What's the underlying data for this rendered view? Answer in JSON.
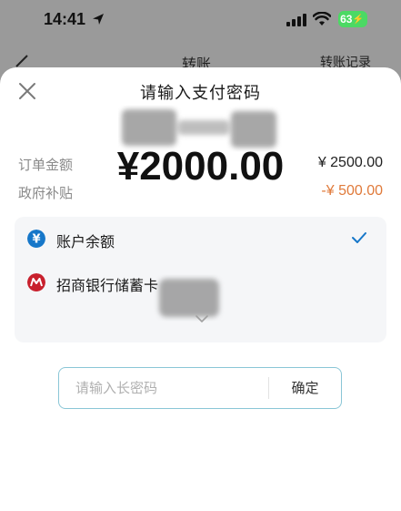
{
  "status_bar": {
    "time": "14:41",
    "battery": "63",
    "icons": [
      "location-arrow-icon",
      "signal-bars-icon",
      "wifi-icon",
      "battery-charging-icon"
    ]
  },
  "background_page": {
    "title": "转账",
    "right_link": "转账记录"
  },
  "sheet": {
    "title": "请输入支付密码",
    "amount": "¥2000.00",
    "order_amount": {
      "label": "订单金额",
      "value": "¥ 2500.00"
    },
    "subsidy": {
      "label": "政府补贴",
      "value": "-¥ 500.00"
    },
    "payment_methods": [
      {
        "label": "账户余额",
        "icon": "yuan-coin-icon",
        "selected": true
      },
      {
        "label": "招商银行储蓄卡",
        "icon": "cmb-bank-icon",
        "selected": false
      }
    ],
    "password_placeholder": "请输入长密码",
    "confirm_label": "确定"
  },
  "colors": {
    "accent_blue": "#1677c9",
    "discount_orange": "#e07a3a",
    "bank_red": "#c8202d",
    "input_border": "#8ac6d6"
  }
}
